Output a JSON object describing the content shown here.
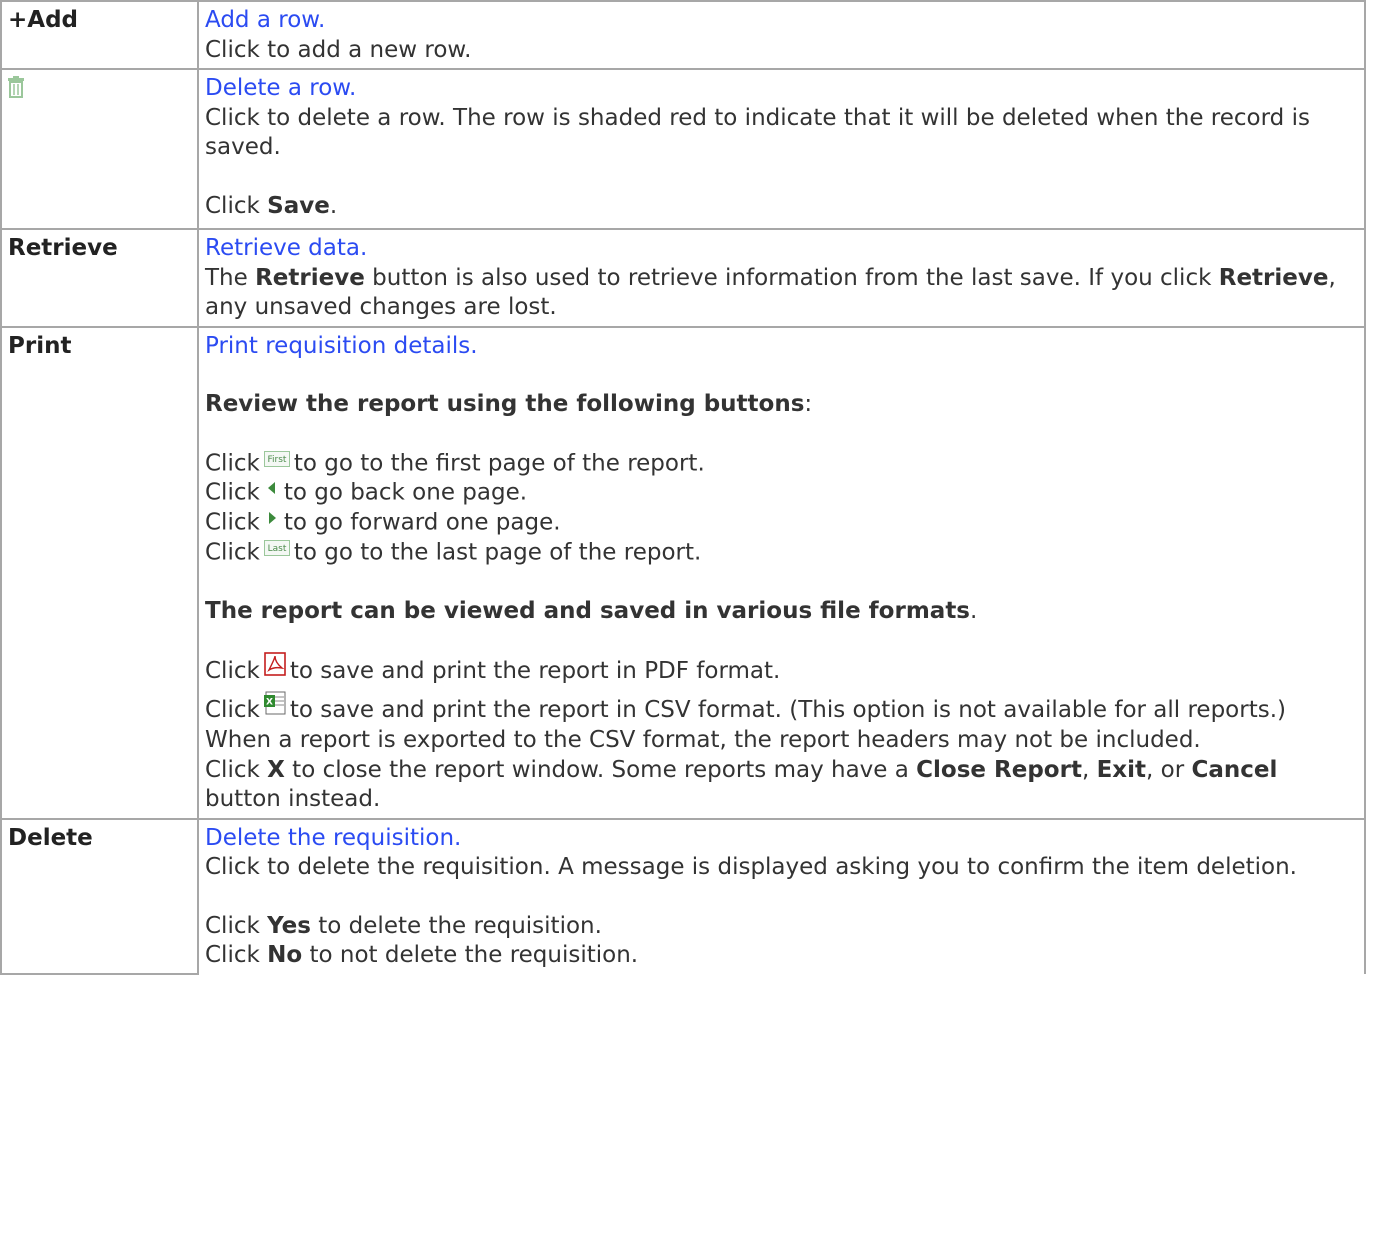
{
  "rows": {
    "add": {
      "name": "+Add",
      "link": "Add a row.",
      "line1": "Click to add a new row."
    },
    "delete_row": {
      "icon": "trash-icon",
      "link": "Delete a row.",
      "line1": "Click to delete a row. The row is shaded red to indicate that it will be deleted when the record is saved.",
      "click": "Click ",
      "save_bold": "Save",
      "period": "."
    },
    "retrieve": {
      "name": "Retrieve",
      "link": "Retrieve data.",
      "t1": "The ",
      "b1": "Retrieve",
      "t2": " button is also used to retrieve information from the last save. If you click ",
      "b2": "Retrieve",
      "t3": ", any unsaved changes are lost."
    },
    "print": {
      "name": "Print",
      "link": "Print requisition details.",
      "review_bold": "Review the report using the following buttons",
      "colon": ":",
      "click": "Click",
      "first_text": "to go to the first page of the report.",
      "prev_text": "to go back one page.",
      "next_text": "to go forward one page.",
      "last_text": "to go to the last page of the report.",
      "first_icon_label": "First",
      "last_icon_label": "Last",
      "formats_bold": "The report can be viewed and saved in various file formats",
      "period": ".",
      "pdf_text": "to save and print the report in PDF format.",
      "csv_text": "to save and print the report in CSV format. (This option is not available for all reports.) When a report is exported to the CSV format, the report headers may not be included.",
      "x_t1": "Click ",
      "x_b": "X",
      "x_t2": " to close the report window. Some reports may have a ",
      "x_b2": "Close Report",
      "x_t3": ", ",
      "x_b3": "Exit",
      "x_t4": ", or ",
      "x_b4": "Cancel",
      "x_t5": " button instead."
    },
    "delete_req": {
      "name": "Delete",
      "link": "Delete the requisition.",
      "line1": "Click to delete the requisition. A message is displayed asking you to confirm the item deletion.",
      "click": "Click ",
      "yes_bold": "Yes",
      "yes_text": " to delete the requisition.",
      "no_bold": "No",
      "no_text": " to not delete the requisition."
    }
  },
  "colors": {
    "link": "#2b4bf2",
    "border": "#a7a7a7",
    "text": "#333333"
  }
}
